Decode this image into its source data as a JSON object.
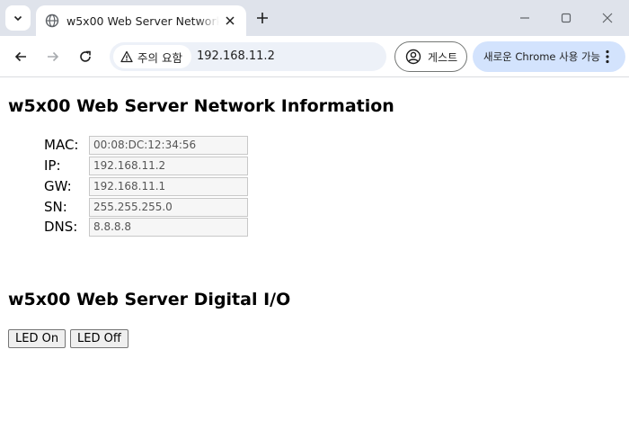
{
  "browser": {
    "tab": {
      "title": "w5x00 Web Server Network Information"
    },
    "toolbar": {
      "security_chip": "주의 요함",
      "url": "192.168.11.2",
      "guest_label": "게스트",
      "update_label": "새로운 Chrome 사용 가능"
    },
    "icons": [
      "chevron-down-icon",
      "globe-icon",
      "close-icon",
      "plus-icon",
      "minimize-icon",
      "maximize-icon",
      "window-close-icon",
      "back-arrow-icon",
      "forward-arrow-icon",
      "reload-icon",
      "warning-icon",
      "person-icon",
      "kebab-menu-icon"
    ]
  },
  "page": {
    "network_heading": "w5x00 Web Server Network Information",
    "network_fields": [
      {
        "label": "MAC:",
        "value": "00:08:DC:12:34:56"
      },
      {
        "label": "IP:",
        "value": "192.168.11.2"
      },
      {
        "label": "GW:",
        "value": "192.168.11.1"
      },
      {
        "label": "SN:",
        "value": "255.255.255.0"
      },
      {
        "label": "DNS:",
        "value": "8.8.8.8"
      }
    ],
    "io_heading": "w5x00 Web Server Digital I/O",
    "buttons": {
      "led_on": "LED On",
      "led_off": "LED Off"
    }
  }
}
